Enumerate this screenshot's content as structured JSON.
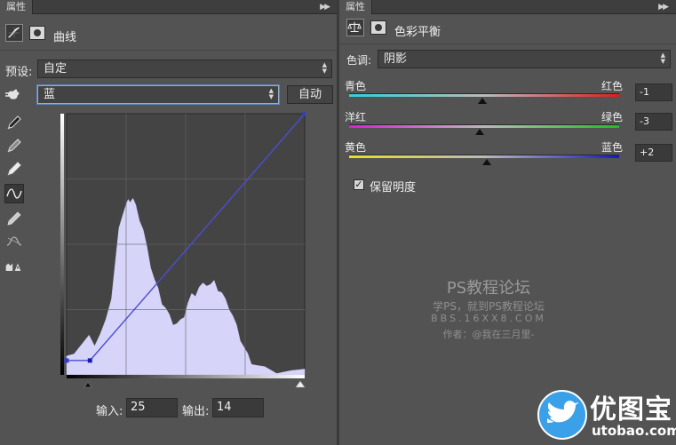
{
  "left_panel": {
    "tab_title": "属性",
    "header_title": "曲线",
    "preset_label": "预设:",
    "preset_value": "自定",
    "channel_value": "蓝",
    "auto_label": "自动",
    "input_label": "输入:",
    "input_value": "25",
    "output_label": "输出:",
    "output_value": "14",
    "curve_point": {
      "input": 25,
      "output": 14
    }
  },
  "right_panel": {
    "tab_title": "属性",
    "header_title": "色彩平衡",
    "tone_label": "色调:",
    "tone_value": "阴影",
    "sliders": [
      {
        "left": "青色",
        "right": "红色",
        "value": "-1",
        "gradient": [
          "#2fd0d8",
          "#d82020"
        ]
      },
      {
        "left": "洋红",
        "right": "绿色",
        "value": "-3",
        "gradient": [
          "#d820d8",
          "#20c020"
        ]
      },
      {
        "left": "黄色",
        "right": "蓝色",
        "value": "+2",
        "gradient": [
          "#e8e020",
          "#1818c8"
        ]
      }
    ],
    "preserve_label": "保留明度",
    "preserve_checked": true
  },
  "watermark": {
    "title": "PS教程论坛",
    "line2": "学PS，就到PS教程论坛",
    "line3": "BBS.16XX8.COM",
    "line4": "作者：@我在三月里-"
  },
  "logo": {
    "name": "优图宝",
    "domain": "utobao.com"
  },
  "colors": {
    "panel_bg": "#535353",
    "histogram_fill": "#d6d4f8",
    "curve_line": "#4b4ed0",
    "focus_ring": "#8faed6"
  },
  "icons": {
    "curves": "curves-adjustment-icon",
    "mask": "mask-icon",
    "hand": "targeted-adjust-hand-icon",
    "black_point": "eyedropper-black-icon",
    "gray_point": "eyedropper-gray-icon",
    "white_point": "eyedropper-white-icon",
    "curve_tool": "curve-tool-icon",
    "pencil": "pencil-tool-icon",
    "smooth": "smooth-curve-icon",
    "clipping": "clipping-warning-icon",
    "balance": "color-balance-icon"
  }
}
